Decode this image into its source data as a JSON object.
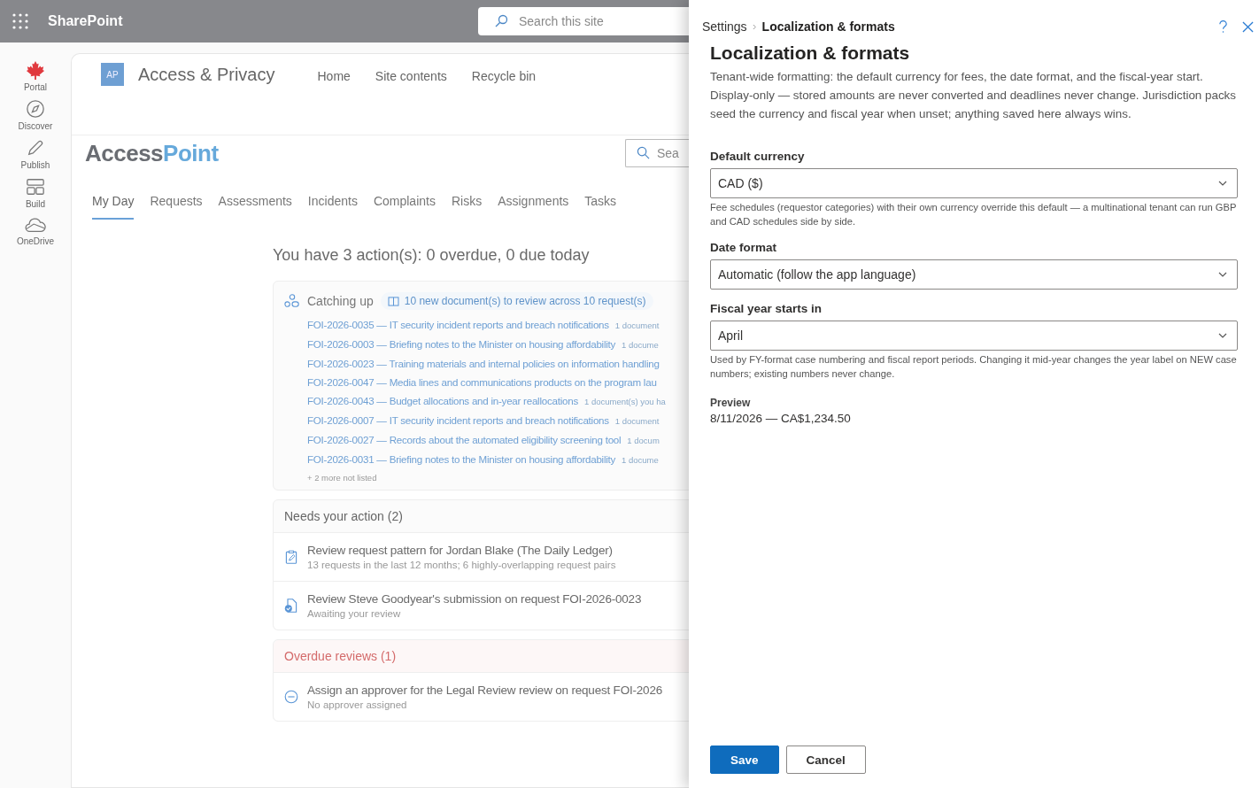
{
  "topbar": {
    "app": "SharePoint",
    "search": {
      "placeholder": "Search this site"
    }
  },
  "rail": [
    {
      "kind": "leaf",
      "label": "Portal"
    },
    {
      "kind": "compass",
      "label": "Discover"
    },
    {
      "kind": "pen",
      "label": "Publish"
    },
    {
      "kind": "build",
      "label": "Build"
    },
    {
      "kind": "cloud",
      "label": "OneDrive"
    }
  ],
  "site": {
    "initials": "AP",
    "title": "Access & Privacy",
    "nav": [
      "Home",
      "Site contents",
      "Recycle bin"
    ]
  },
  "app": {
    "logo": {
      "first": "Access",
      "second": "Point"
    },
    "search": {
      "placeholder": "Sea"
    },
    "tabs": [
      {
        "label": "My Day",
        "selected": true
      },
      {
        "label": "Requests",
        "selected": false
      },
      {
        "label": "Assessments",
        "selected": false
      },
      {
        "label": "Incidents",
        "selected": false
      },
      {
        "label": "Complaints",
        "selected": false
      },
      {
        "label": "Risks",
        "selected": false
      },
      {
        "label": "Assignments",
        "selected": false
      },
      {
        "label": "Tasks",
        "selected": false
      }
    ],
    "summary": "You have 3 action(s): 0 overdue, 0 due today",
    "catching_up": {
      "title": "Catching up",
      "badge": "10 new document(s) to review across 10 request(s)",
      "items": [
        {
          "text": "FOI-2026-0035 — IT security incident reports and breach notifications",
          "note": "1 document"
        },
        {
          "text": "FOI-2026-0003 — Briefing notes to the Minister on housing affordability",
          "note": "1 docume"
        },
        {
          "text": "FOI-2026-0023 — Training materials and internal policies on information handling"
        },
        {
          "text": "FOI-2026-0047 — Media lines and communications products on the program lau"
        },
        {
          "text": "FOI-2026-0043 — Budget allocations and in-year reallocations",
          "note": "1 document(s) you ha"
        },
        {
          "text": "FOI-2026-0007 — IT security incident reports and breach notifications",
          "note": "1 document"
        },
        {
          "text": "FOI-2026-0027 — Records about the automated eligibility screening tool",
          "note": "1 docum"
        },
        {
          "text": "FOI-2026-0031 — Briefing notes to the Minister on housing affordability",
          "note": "1 docume"
        }
      ],
      "more": "+ 2 more not listed"
    },
    "groups": [
      {
        "kind": "normal",
        "title": "Needs your action (2)",
        "items": [
          {
            "kind": "clipboard",
            "title": "Review request pattern for Jordan Blake (The Daily Ledger)",
            "subtitle": "13 requests in the last 12 months; 6 highly-overlapping request pairs"
          },
          {
            "kind": "document-check",
            "title": "Review Steve Goodyear's submission on request FOI-2026-0023",
            "subtitle": "Awaiting your review"
          }
        ]
      },
      {
        "kind": "overdue",
        "title": "Overdue reviews (1)",
        "items": [
          {
            "kind": "minus-circle",
            "title": "Assign an approver for the Legal Review review on request FOI-2026",
            "subtitle": "No approver assigned"
          }
        ]
      }
    ]
  },
  "panel": {
    "breadcrumb": [
      "Settings",
      "Localization & formats"
    ],
    "title": "Localization & formats",
    "description": "Tenant-wide formatting: the default currency for fees, the date format, and the fiscal-year start. Display-only — stored amounts are never converted and deadlines never change. Jurisdiction packs seed the currency and fiscal year when unset; anything saved here always wins.",
    "fields": [
      {
        "label": "Default currency",
        "value": "CAD ($)",
        "help": "Fee schedules (requestor categories) with their own currency override this default — a multinational tenant can run GBP and CAD schedules side by side."
      },
      {
        "label": "Date format",
        "value": "Automatic (follow the app language)"
      },
      {
        "label": "Fiscal year starts in",
        "value": "April",
        "help": "Used by FY-format case numbering and fiscal report periods. Changing it mid-year changes the year label on NEW case numbers; existing numbers never change."
      }
    ],
    "preview": {
      "label": "Preview",
      "value": "8/11/2026 — CA$1,234.50"
    },
    "buttons": [
      {
        "kind": "primary",
        "label": "Save"
      },
      {
        "kind": "secondary",
        "label": "Cancel"
      }
    ]
  }
}
